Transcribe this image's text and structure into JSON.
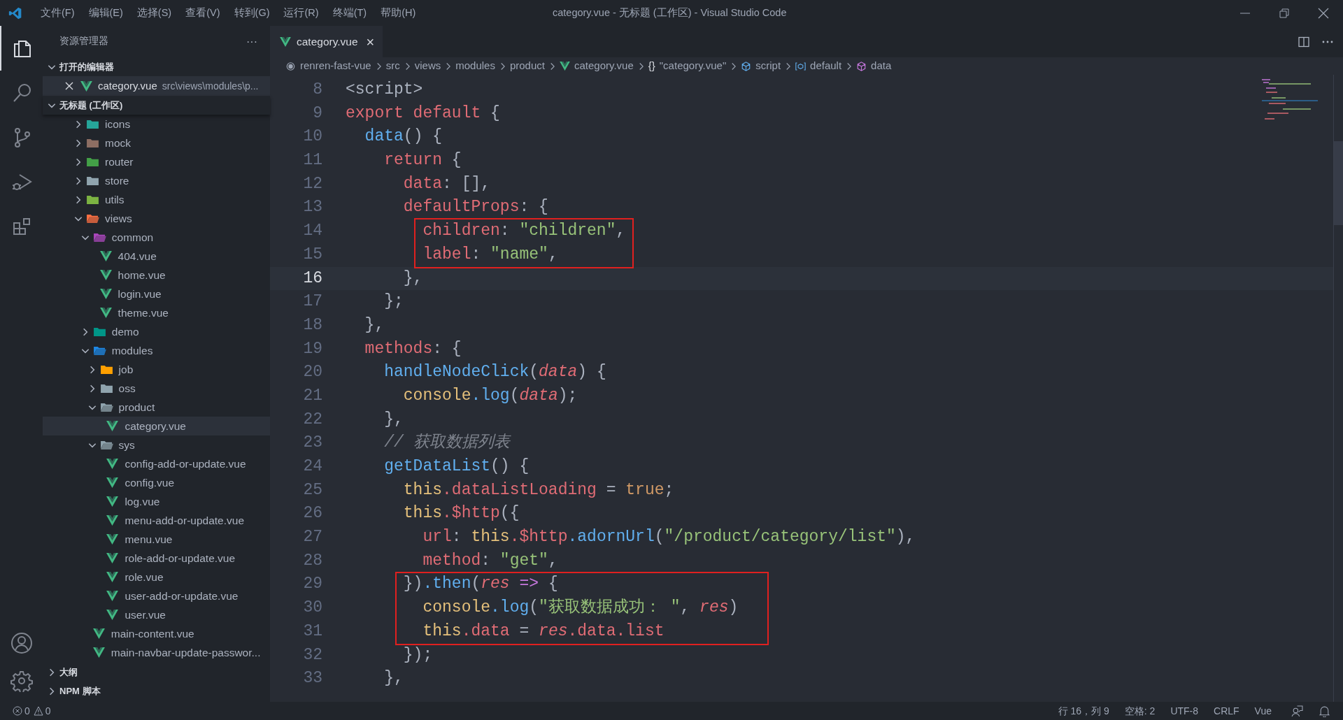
{
  "window": {
    "title": "category.vue - 无标题 (工作区) - Visual Studio Code"
  },
  "menu": [
    "文件(F)",
    "编辑(E)",
    "选择(S)",
    "查看(V)",
    "转到(G)",
    "运行(R)",
    "终端(T)",
    "帮助(H)"
  ],
  "activity_bar": [
    {
      "kind": "files",
      "selected": true
    },
    {
      "kind": "search",
      "selected": false
    },
    {
      "kind": "source-control",
      "selected": false
    },
    {
      "kind": "debug",
      "selected": false
    },
    {
      "kind": "extensions",
      "selected": false
    }
  ],
  "sidebar": {
    "title": "资源管理器",
    "more": "···",
    "open_editors": {
      "title": "打开的编辑器",
      "expanded": true,
      "items": [
        {
          "name": "category.vue",
          "path": "src\\views\\modules\\p..."
        }
      ]
    },
    "workspace": {
      "title": "无标题 (工作区)",
      "expanded": true,
      "items": [
        {
          "kind": "folder",
          "name": "icons",
          "color": "#26a69a",
          "expanded": false,
          "selected": false
        },
        {
          "kind": "folder",
          "name": "mock",
          "color": "#8d6e63",
          "expanded": false,
          "selected": false
        },
        {
          "kind": "folder",
          "name": "router",
          "color": "#43a047",
          "expanded": false,
          "selected": false
        },
        {
          "kind": "folder",
          "name": "store",
          "color": "#90a4ae",
          "expanded": false,
          "selected": false
        },
        {
          "kind": "folder",
          "name": "utils",
          "color": "#7cb342",
          "expanded": false,
          "selected": false
        },
        {
          "kind": "folder",
          "name": "views",
          "color": "#ff7043",
          "expanded": true,
          "selected": false,
          "children": [
            {
              "kind": "folder",
              "name": "common",
              "color": "#ab47bc",
              "expanded": true,
              "selected": false,
              "children": [
                {
                  "kind": "vue",
                  "name": "404.vue",
                  "selected": false
                },
                {
                  "kind": "vue",
                  "name": "home.vue",
                  "selected": false
                },
                {
                  "kind": "vue",
                  "name": "login.vue",
                  "selected": false
                },
                {
                  "kind": "vue",
                  "name": "theme.vue",
                  "selected": false
                }
              ]
            },
            {
              "kind": "folder",
              "name": "demo",
              "color": "#009688",
              "expanded": false,
              "selected": false
            },
            {
              "kind": "folder",
              "name": "modules",
              "color": "#1e88e5",
              "expanded": true,
              "selected": false,
              "children": [
                {
                  "kind": "folder",
                  "name": "job",
                  "color": "#ffa000",
                  "expanded": false,
                  "selected": false
                },
                {
                  "kind": "folder",
                  "name": "oss",
                  "color": "#90a4ae",
                  "expanded": false,
                  "selected": false
                },
                {
                  "kind": "folder",
                  "name": "product",
                  "color": "#90a4ae",
                  "expanded": true,
                  "selected": false,
                  "children": [
                    {
                      "kind": "vue",
                      "name": "category.vue",
                      "selected": true
                    }
                  ]
                },
                {
                  "kind": "folder",
                  "name": "sys",
                  "color": "#90a4ae",
                  "expanded": true,
                  "selected": false,
                  "children": [
                    {
                      "kind": "vue",
                      "name": "config-add-or-update.vue",
                      "selected": false
                    },
                    {
                      "kind": "vue",
                      "name": "config.vue",
                      "selected": false
                    },
                    {
                      "kind": "vue",
                      "name": "log.vue",
                      "selected": false
                    },
                    {
                      "kind": "vue",
                      "name": "menu-add-or-update.vue",
                      "selected": false
                    },
                    {
                      "kind": "vue",
                      "name": "menu.vue",
                      "selected": false
                    },
                    {
                      "kind": "vue",
                      "name": "role-add-or-update.vue",
                      "selected": false
                    },
                    {
                      "kind": "vue",
                      "name": "role.vue",
                      "selected": false
                    },
                    {
                      "kind": "vue",
                      "name": "user-add-or-update.vue",
                      "selected": false
                    },
                    {
                      "kind": "vue",
                      "name": "user.vue",
                      "selected": false
                    }
                  ]
                }
              ]
            },
            {
              "kind": "vue",
              "name": "main-content.vue",
              "selected": false
            },
            {
              "kind": "vue",
              "name": "main-navbar-update-passwor...",
              "selected": false
            }
          ]
        }
      ]
    },
    "sections": [
      {
        "title": "大纲",
        "expanded": false
      },
      {
        "title": "NPM 脚本",
        "expanded": false
      }
    ]
  },
  "tabs": [
    {
      "label": "category.vue",
      "close": "×",
      "selected": true
    }
  ],
  "breadcrumb": [
    {
      "kind": "root",
      "label": "renren-fast-vue"
    },
    {
      "kind": "plain",
      "label": "src"
    },
    {
      "kind": "plain",
      "label": "views"
    },
    {
      "kind": "plain",
      "label": "modules"
    },
    {
      "kind": "plain",
      "label": "product"
    },
    {
      "kind": "vue",
      "label": "category.vue"
    },
    {
      "kind": "braces",
      "glyph": "{}",
      "label": "\"category.vue\""
    },
    {
      "kind": "module",
      "label": "script"
    },
    {
      "kind": "field",
      "label": "default"
    },
    {
      "kind": "method",
      "label": "data"
    }
  ],
  "code_lines": [
    {
      "number": "8",
      "current": false,
      "framed": false,
      "tokens": [
        {
          "kind": "tag",
          "text": "<script>"
        }
      ]
    },
    {
      "number": "9",
      "current": false,
      "framed": false,
      "tokens": [
        {
          "kind": "kw",
          "text": "export default"
        },
        {
          "kind": "plain",
          "text": " {"
        }
      ]
    },
    {
      "number": "10",
      "current": false,
      "framed": false,
      "tokens": [
        {
          "kind": "fn",
          "text": "  data"
        },
        {
          "kind": "plain",
          "text": "() {"
        }
      ]
    },
    {
      "number": "11",
      "current": false,
      "framed": false,
      "tokens": [
        {
          "kind": "kw",
          "text": "    return"
        },
        {
          "kind": "plain",
          "text": " {"
        }
      ]
    },
    {
      "number": "12",
      "current": false,
      "framed": false,
      "tokens": [
        {
          "kind": "key",
          "text": "      data"
        },
        {
          "kind": "plain",
          "text": ": [],"
        }
      ]
    },
    {
      "number": "13",
      "current": false,
      "framed": false,
      "tokens": [
        {
          "kind": "key",
          "text": "      defaultProps"
        },
        {
          "kind": "plain",
          "text": ": {"
        }
      ]
    },
    {
      "number": "14",
      "current": false,
      "framed": true,
      "tokens": [
        {
          "kind": "key",
          "text": "        children"
        },
        {
          "kind": "plain",
          "text": ": "
        },
        {
          "kind": "str",
          "text": "\"children\""
        },
        {
          "kind": "plain",
          "text": ","
        }
      ]
    },
    {
      "number": "15",
      "current": false,
      "framed": true,
      "tokens": [
        {
          "kind": "key",
          "text": "        label"
        },
        {
          "kind": "plain",
          "text": ": "
        },
        {
          "kind": "str",
          "text": "\"name\""
        },
        {
          "kind": "plain",
          "text": ","
        }
      ]
    },
    {
      "number": "16",
      "current": true,
      "framed": false,
      "tokens": [
        {
          "kind": "plain",
          "text": "      },"
        }
      ]
    },
    {
      "number": "17",
      "current": false,
      "framed": false,
      "tokens": [
        {
          "kind": "plain",
          "text": "    };"
        }
      ]
    },
    {
      "number": "18",
      "current": false,
      "framed": false,
      "tokens": [
        {
          "kind": "plain",
          "text": "  },"
        }
      ]
    },
    {
      "number": "19",
      "current": false,
      "framed": false,
      "tokens": [
        {
          "kind": "key",
          "text": "  methods"
        },
        {
          "kind": "plain",
          "text": ": {"
        }
      ]
    },
    {
      "number": "20",
      "current": false,
      "framed": false,
      "tokens": [
        {
          "kind": "fn",
          "text": "    handleNodeClick"
        },
        {
          "kind": "plain",
          "text": "("
        },
        {
          "kind": "param",
          "text": "data"
        },
        {
          "kind": "plain",
          "text": ") {"
        }
      ]
    },
    {
      "number": "21",
      "current": false,
      "framed": false,
      "tokens": [
        {
          "kind": "obj",
          "text": "      console"
        },
        {
          "kind": "fn",
          "text": ".log"
        },
        {
          "kind": "plain",
          "text": "("
        },
        {
          "kind": "param",
          "text": "data"
        },
        {
          "kind": "plain",
          "text": ");"
        }
      ]
    },
    {
      "number": "22",
      "current": false,
      "framed": false,
      "tokens": [
        {
          "kind": "plain",
          "text": "    },"
        }
      ]
    },
    {
      "number": "23",
      "current": false,
      "framed": false,
      "tokens": [
        {
          "kind": "comment",
          "text": "    // 获取数据列表"
        }
      ]
    },
    {
      "number": "24",
      "current": false,
      "framed": false,
      "tokens": [
        {
          "kind": "fn",
          "text": "    getDataList"
        },
        {
          "kind": "plain",
          "text": "() {"
        }
      ]
    },
    {
      "number": "25",
      "current": false,
      "framed": false,
      "tokens": [
        {
          "kind": "obj",
          "text": "      this"
        },
        {
          "kind": "key",
          "text": ".dataListLoading"
        },
        {
          "kind": "plain",
          "text": " = "
        },
        {
          "kind": "bool",
          "text": "true"
        },
        {
          "kind": "plain",
          "text": ";"
        }
      ]
    },
    {
      "number": "26",
      "current": false,
      "framed": false,
      "tokens": [
        {
          "kind": "obj",
          "text": "      this"
        },
        {
          "kind": "key",
          "text": ".$http"
        },
        {
          "kind": "plain",
          "text": "({"
        }
      ]
    },
    {
      "number": "27",
      "current": false,
      "framed": false,
      "tokens": [
        {
          "kind": "key",
          "text": "        url"
        },
        {
          "kind": "plain",
          "text": ": "
        },
        {
          "kind": "obj",
          "text": "this"
        },
        {
          "kind": "key",
          "text": ".$http"
        },
        {
          "kind": "fn",
          "text": ".adornUrl"
        },
        {
          "kind": "plain",
          "text": "("
        },
        {
          "kind": "str",
          "text": "\"/product/category/list\""
        },
        {
          "kind": "plain",
          "text": "),"
        }
      ]
    },
    {
      "number": "28",
      "current": false,
      "framed": false,
      "tokens": [
        {
          "kind": "key",
          "text": "        method"
        },
        {
          "kind": "plain",
          "text": ": "
        },
        {
          "kind": "str",
          "text": "\"get\""
        },
        {
          "kind": "plain",
          "text": ","
        }
      ]
    },
    {
      "number": "29",
      "current": false,
      "framed": true,
      "tokens": [
        {
          "kind": "plain",
          "text": "      })"
        },
        {
          "kind": "fn",
          "text": ".then"
        },
        {
          "kind": "plain",
          "text": "("
        },
        {
          "kind": "param",
          "text": "res"
        },
        {
          "kind": "op",
          "text": " =>"
        },
        {
          "kind": "plain",
          "text": " {"
        }
      ]
    },
    {
      "number": "30",
      "current": false,
      "framed": true,
      "tokens": [
        {
          "kind": "obj",
          "text": "        console"
        },
        {
          "kind": "fn",
          "text": ".log"
        },
        {
          "kind": "plain",
          "text": "("
        },
        {
          "kind": "str",
          "text": "\"获取数据成功： \""
        },
        {
          "kind": "plain",
          "text": ", "
        },
        {
          "kind": "param",
          "text": "res"
        },
        {
          "kind": "plain",
          "text": ")"
        }
      ]
    },
    {
      "number": "31",
      "current": false,
      "framed": true,
      "tokens": [
        {
          "kind": "obj",
          "text": "        this"
        },
        {
          "kind": "key",
          "text": ".data"
        },
        {
          "kind": "plain",
          "text": " = "
        },
        {
          "kind": "param",
          "text": "res"
        },
        {
          "kind": "key",
          "text": ".data.list"
        }
      ]
    },
    {
      "number": "32",
      "current": false,
      "framed": false,
      "tokens": [
        {
          "kind": "plain",
          "text": "      });"
        }
      ]
    },
    {
      "number": "33",
      "current": false,
      "framed": false,
      "tokens": [
        {
          "kind": "plain",
          "text": "    },"
        }
      ]
    }
  ],
  "status_bar": {
    "errors": "0",
    "warnings": "0",
    "items": [
      "行 16，列 9",
      "空格: 2",
      "UTF-8",
      "CRLF",
      "Vue"
    ]
  }
}
